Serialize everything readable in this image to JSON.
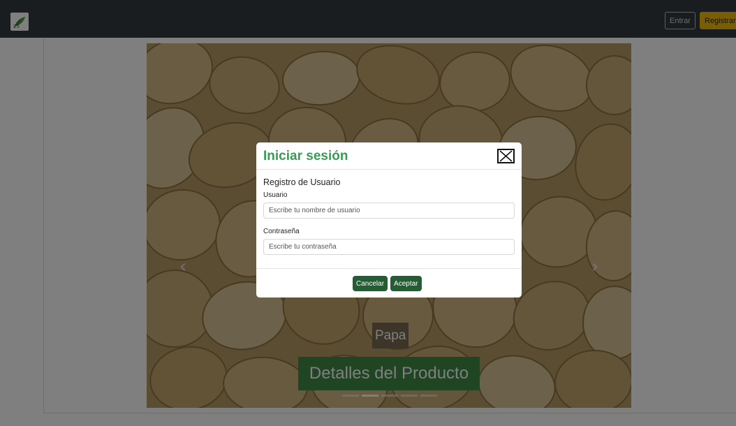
{
  "navbar": {
    "logo_icon": "leaf-logo-icon",
    "login_label": "Entrar",
    "register_label": "Registrar",
    "bg_color": "#343a40",
    "register_color": "#f5bd0a"
  },
  "carousel": {
    "caption_title": "Papa",
    "details_button": "Detalles del Producto",
    "prev_icon": "chevron-left-icon",
    "next_icon": "chevron-right-icon",
    "prev_glyph": "‹",
    "next_glyph": "›",
    "indicators": 5,
    "active_indicator": 2
  },
  "modal": {
    "title": "Iniciar sesión",
    "close_icon": "close-icon",
    "form_heading": "Registro de Usuario",
    "username_label": "Usuario",
    "username_placeholder": "Escribe tu nombre de usuario",
    "password_label": "Contraseña",
    "password_placeholder": "Escribe tu contraseña",
    "cancel_label": "Cancelar",
    "accept_label": "Aceptar",
    "title_color": "#3b9a54",
    "button_color": "#245d33"
  }
}
